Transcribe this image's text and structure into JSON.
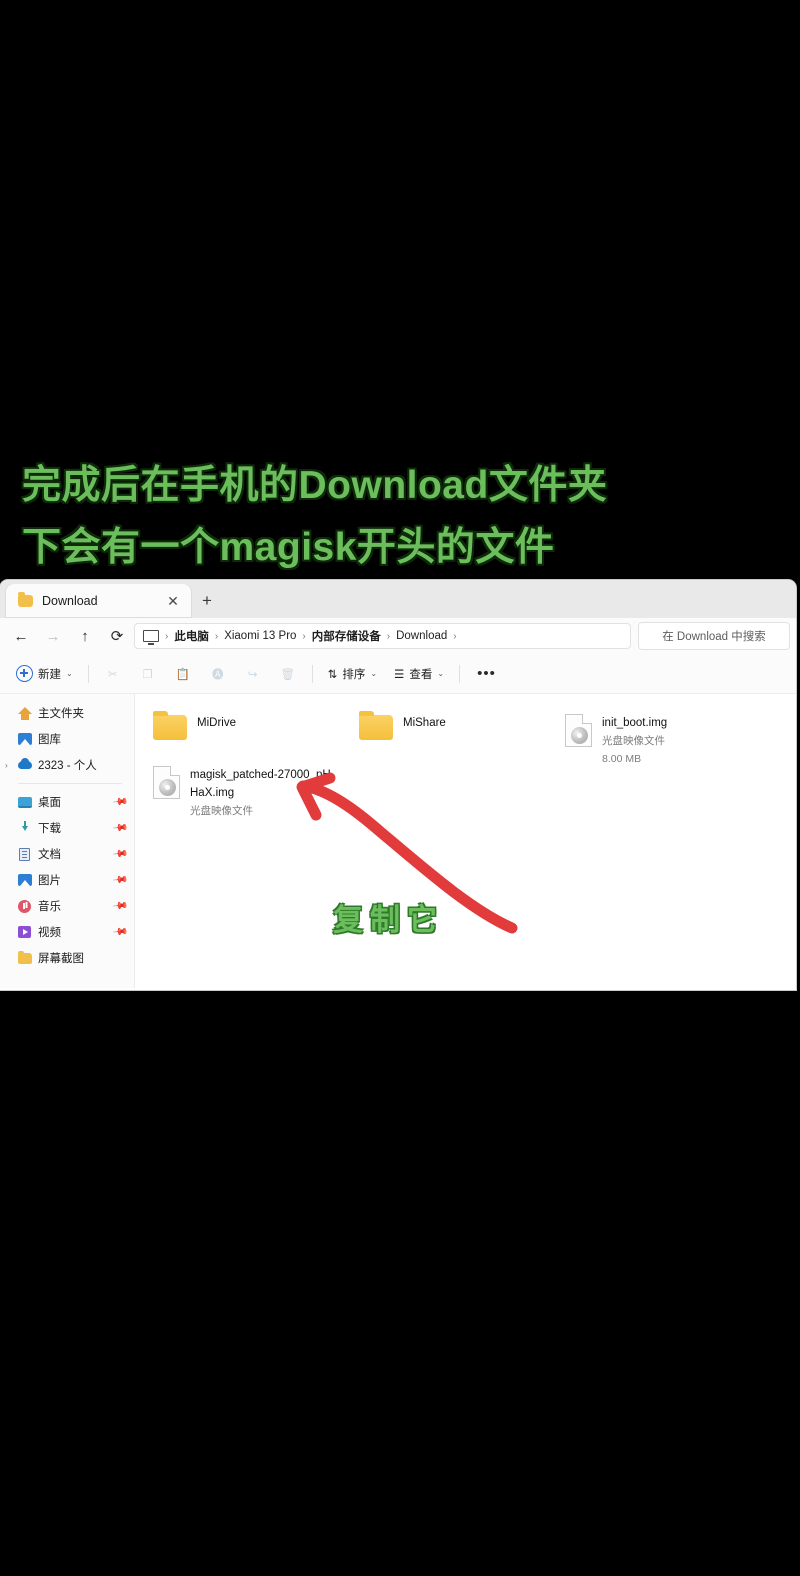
{
  "caption": {
    "text": "完成后在手机的Download文件夹\n下会有一个magisk开头的文件",
    "color": "#6cbd5c"
  },
  "annotation": {
    "copy_it": "复制它",
    "arrow_color": "#e23b3b",
    "text_color": "#6cbd5c"
  },
  "window": {
    "tab": {
      "title": "Download",
      "close_label": "✕",
      "new_tab_label": "+"
    },
    "nav": {
      "back": "←",
      "forward": "→",
      "up": "↑",
      "refresh": "⟳"
    },
    "breadcrumb": {
      "items": [
        "此电脑",
        "Xiaomi 13 Pro",
        "内部存储设备",
        "Download"
      ],
      "separator": "›"
    },
    "search": {
      "placeholder": "在 Download 中搜索"
    },
    "toolbar": {
      "new_label": "新建",
      "sort_label": "排序",
      "view_label": "查看",
      "more_label": "•••",
      "chevron": "⌄",
      "icons": [
        {
          "name": "cut-icon",
          "glyph": "✂"
        },
        {
          "name": "copy-icon",
          "glyph": "❐"
        },
        {
          "name": "paste-icon",
          "glyph": "📋"
        },
        {
          "name": "rename-icon",
          "glyph": "🅐"
        },
        {
          "name": "share-icon",
          "glyph": "↪"
        },
        {
          "name": "delete-icon",
          "glyph": "🗑"
        }
      ]
    },
    "sidebar": {
      "top": [
        {
          "label": "主文件夹",
          "icon": "home-icon",
          "expand": "",
          "pin": ""
        },
        {
          "label": "图库",
          "icon": "gallery-icon",
          "expand": "",
          "pin": ""
        },
        {
          "label": "2323 - 个人",
          "icon": "onedrive-cloud-icon",
          "expand": "›",
          "pin": ""
        }
      ],
      "bottom": [
        {
          "label": "桌面",
          "icon": "desktop-icon",
          "pin": "📌"
        },
        {
          "label": "下载",
          "icon": "downloads-icon",
          "pin": "📌"
        },
        {
          "label": "文档",
          "icon": "documents-icon",
          "pin": "📌"
        },
        {
          "label": "图片",
          "icon": "pictures-icon",
          "pin": "📌"
        },
        {
          "label": "音乐",
          "icon": "music-icon",
          "pin": "📌"
        },
        {
          "label": "视频",
          "icon": "videos-icon",
          "pin": "📌"
        },
        {
          "label": "屏幕截图",
          "icon": "folder-icon",
          "pin": ""
        }
      ]
    },
    "files": [
      {
        "name": "MiDrive",
        "kind": "folder",
        "subtitle": "",
        "size": ""
      },
      {
        "name": "MiShare",
        "kind": "folder",
        "subtitle": "",
        "size": ""
      },
      {
        "name": "init_boot.img",
        "kind": "disc-image",
        "subtitle": "光盘映像文件",
        "size": "8.00 MB"
      },
      {
        "name": "magisk_patched-27000_pHHaX.img",
        "kind": "disc-image",
        "subtitle": "光盘映像文件",
        "size": ""
      }
    ]
  }
}
